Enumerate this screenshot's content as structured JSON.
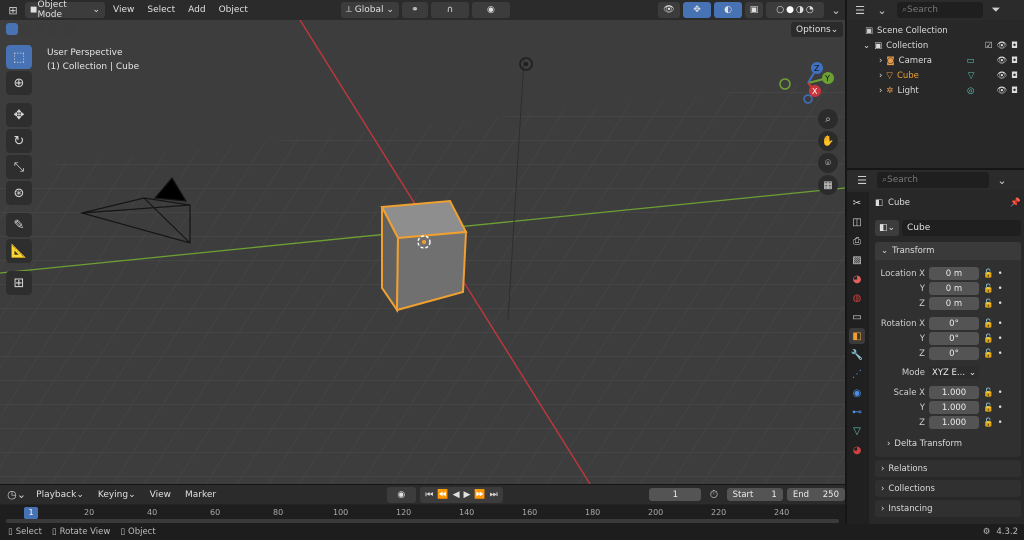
{
  "header": {
    "mode": "Object Mode",
    "menus": [
      "View",
      "Select",
      "Add",
      "Object"
    ],
    "orientation": "Global",
    "options_label": "Options"
  },
  "viewport": {
    "perspective": "User Perspective",
    "context": "(1) Collection | Cube",
    "gizmo": {
      "x": "X",
      "y": "Y",
      "z": "Z"
    }
  },
  "outliner": {
    "search_placeholder": "Search",
    "scene_collection": "Scene Collection",
    "collection": "Collection",
    "items": [
      {
        "label": "Camera",
        "color": "#d8d8d8"
      },
      {
        "label": "Cube",
        "color": "#f0a030"
      },
      {
        "label": "Light",
        "color": "#d8d8d8"
      }
    ]
  },
  "properties": {
    "search_placeholder": "Search",
    "object_name": "Cube",
    "datablock_name": "Cube",
    "transform_label": "Transform",
    "location_label": "Location X",
    "rotation_label": "Rotation X",
    "axis_y": "Y",
    "axis_z": "Z",
    "location": [
      "0 m",
      "0 m",
      "0 m"
    ],
    "rotation": [
      "0°",
      "0°",
      "0°"
    ],
    "mode_label": "Mode",
    "mode_value": "XYZ E...",
    "scale_label": "Scale X",
    "scale": [
      "1.000",
      "1.000",
      "1.000"
    ],
    "delta_transform": "Delta Transform",
    "sections": [
      "Relations",
      "Collections",
      "Instancing"
    ]
  },
  "timeline": {
    "menus": [
      "Playback",
      "Keying",
      "View",
      "Marker"
    ],
    "current_frame": "1",
    "start_label": "Start",
    "start_value": "1",
    "end_label": "End",
    "end_value": "250",
    "ruler_marks": [
      "1",
      "20",
      "40",
      "60",
      "80",
      "100",
      "120",
      "140",
      "160",
      "180",
      "200",
      "220",
      "240"
    ]
  },
  "statusbar": {
    "select": "Select",
    "rotate_view": "Rotate View",
    "object": "Object",
    "version": "4.3.2"
  },
  "colors": {
    "accent": "#4772b3",
    "selection": "#f0a030",
    "x_axis": "#c8363c",
    "y_axis": "#6ca034"
  }
}
